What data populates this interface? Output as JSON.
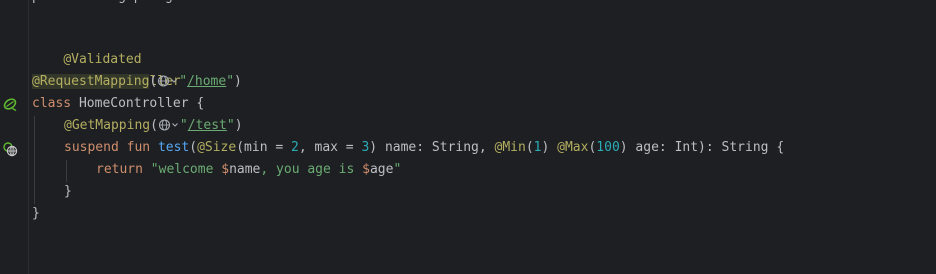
{
  "editor": {
    "top_fragment": "p          g p   g",
    "lines": {
      "l1_ann": "@Validated",
      "l2_ann": "@RestController",
      "l3_ann": "@RequestMapping",
      "l3_open": "(",
      "l3_q1": "\"",
      "l3_path": "/home",
      "l3_q2": "\"",
      "l3_close": ")",
      "l4_kw": "class",
      "l4_rest": " HomeController {",
      "l5_ann": "@GetMapping",
      "l5_open": "(",
      "l5_q1": "\"",
      "l5_path": "/test",
      "l5_q2": "\"",
      "l5_close": ")",
      "l6_kw1": "suspend",
      "l6_sp1": " ",
      "l6_kw2": "fun",
      "l6_sp2": " ",
      "l6_fn": "test",
      "l6_p1": "(",
      "l6_ann1": "@Size",
      "l6_p2": "(min = ",
      "l6_n1": "2",
      "l6_p3": ", max = ",
      "l6_n2": "3",
      "l6_p4": ") name: String, ",
      "l6_ann2": "@Min",
      "l6_p5": "(",
      "l6_n3": "1",
      "l6_p6": ") ",
      "l6_ann3": "@Max",
      "l6_p7": "(",
      "l6_n4": "100",
      "l6_p8": ") age: Int): String {",
      "l7_kw": "return",
      "l7_s1": " \"welcome ",
      "l7_t1": "$",
      "l7_v1": "name",
      "l7_s2": ", you age is ",
      "l7_t2": "$",
      "l7_v2": "age",
      "l7_s3": "\"",
      "l8_brace": "}",
      "l9_brace": "}"
    }
  },
  "gutter_icons": [
    "spring-bean-icon",
    "web-endpoint-icon"
  ],
  "inlay_icon": "globe-endpoint-icon",
  "colors": {
    "background": "#1e1f22",
    "annotation": "#b3ae60",
    "keyword": "#cf8e6d",
    "function": "#56a8f5",
    "string": "#6aab73",
    "number": "#2aacb8",
    "text": "#bcbec4"
  }
}
